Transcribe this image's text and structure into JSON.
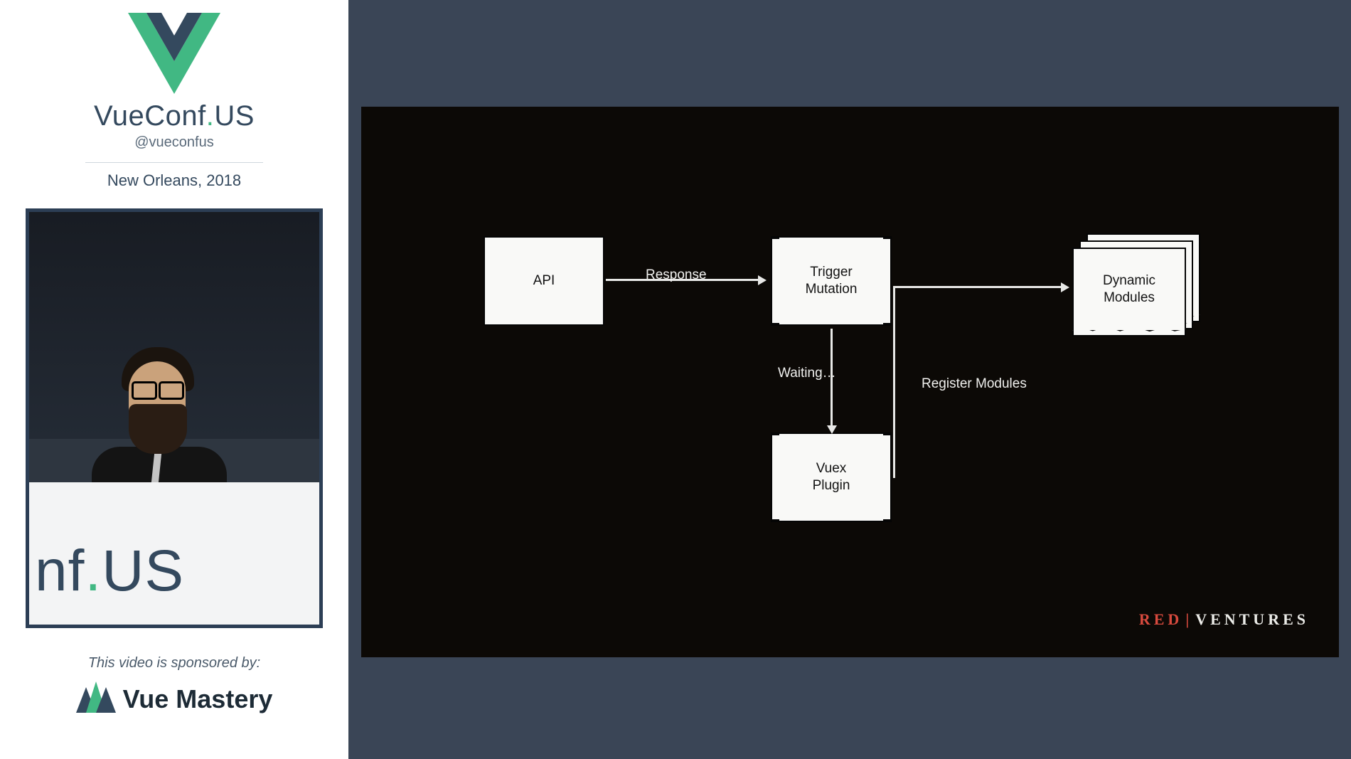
{
  "sidebar": {
    "conf_name_a": "VueConf",
    "conf_name_dot": ".",
    "conf_name_b": "US",
    "handle": "@vueconfus",
    "location": "New Orleans, 2018",
    "podium_a": "nf",
    "podium_dot": ".",
    "podium_b": "US",
    "sponsor_line": "This video is sponsored by:",
    "sponsor_name": "Vue Mastery"
  },
  "slide": {
    "boxes": {
      "api": "API",
      "trigger": "Trigger\nMutation",
      "plugin": "Vuex\nPlugin",
      "modules": "Dynamic\nModules"
    },
    "labels": {
      "response": "Response",
      "waiting": "Waiting…",
      "register": "Register Modules"
    },
    "footer": {
      "red": "RED",
      "rest": "VENTURES"
    }
  },
  "chart_data": {
    "type": "diagram",
    "title": "",
    "nodes": [
      {
        "id": "api",
        "label": "API",
        "shape": "rect"
      },
      {
        "id": "trigger",
        "label": "Trigger Mutation",
        "shape": "rect-banded"
      },
      {
        "id": "plugin",
        "label": "Vuex Plugin",
        "shape": "rect-banded"
      },
      {
        "id": "modules",
        "label": "Dynamic Modules",
        "shape": "stacked-document"
      }
    ],
    "edges": [
      {
        "from": "api",
        "to": "trigger",
        "label": "Response"
      },
      {
        "from": "trigger",
        "to": "plugin",
        "label": "Waiting…"
      },
      {
        "from": "plugin",
        "to": "modules",
        "label": "Register Modules"
      }
    ]
  }
}
